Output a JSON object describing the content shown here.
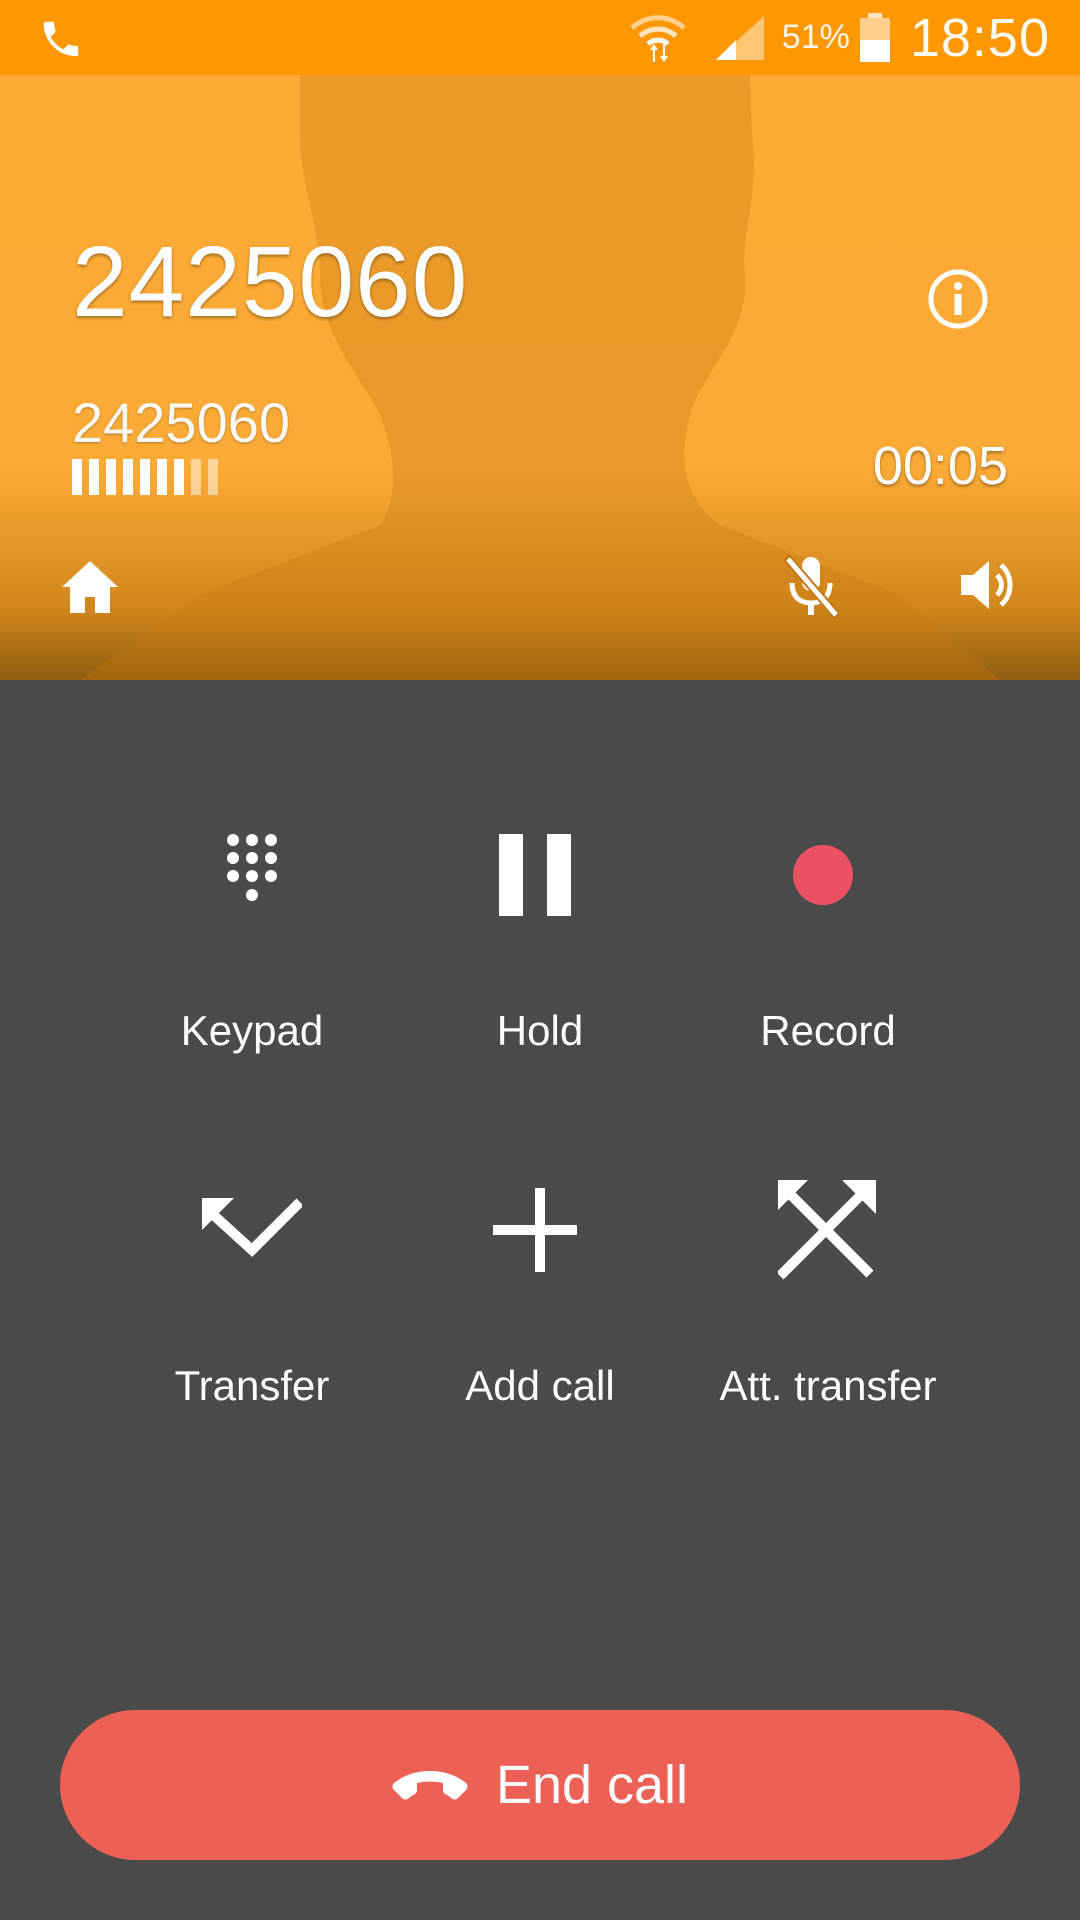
{
  "status_bar": {
    "left_icon": "phone-icon",
    "battery_percent": "51%",
    "time": "18:50",
    "icons": [
      "wifi-icon",
      "signal-icon",
      "battery-icon"
    ]
  },
  "call": {
    "caller_name": "2425060",
    "caller_number": "2425060",
    "timer": "00:05",
    "quality_level": 7,
    "quality_max": 9,
    "header_icons": [
      "info-icon",
      "home-icon",
      "mic-off-icon",
      "speaker-icon"
    ]
  },
  "actions": [
    {
      "label": "Keypad",
      "icon": "keypad-icon"
    },
    {
      "label": "Hold",
      "icon": "pause-icon"
    },
    {
      "label": "Record",
      "icon": "record-icon"
    },
    {
      "label": "Transfer",
      "icon": "transfer-icon"
    },
    {
      "label": "Add call",
      "icon": "add-call-icon"
    },
    {
      "label": "Att. transfer",
      "icon": "attended-transfer-icon"
    }
  ],
  "end_call": {
    "label": "End call",
    "icon": "hangup-icon"
  },
  "colors": {
    "status_bar": "#ff9800",
    "header": "#fdab34",
    "background": "#4a4a4a",
    "record": "#ec5063",
    "end_call": "#ed6055"
  }
}
